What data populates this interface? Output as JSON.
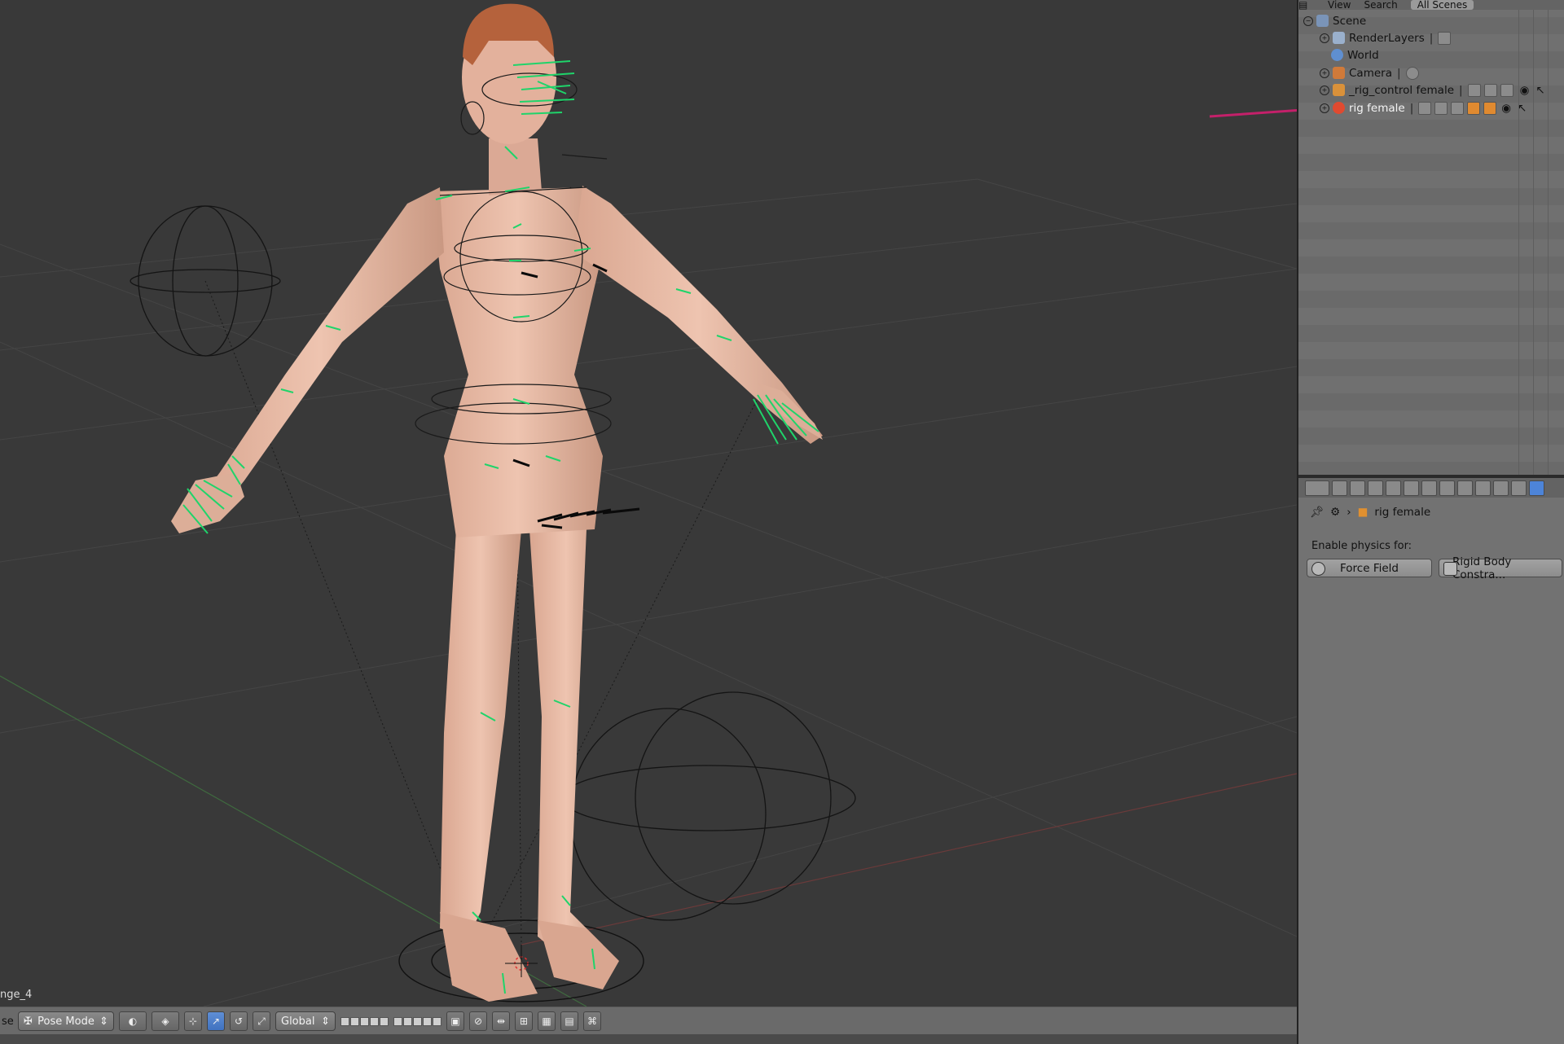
{
  "viewport": {
    "object_label": "nge_4"
  },
  "view3d_header": {
    "left_fragment": "se",
    "mode": "Pose Mode",
    "orientation": "Global"
  },
  "outliner": {
    "menus": [
      "View",
      "Search"
    ],
    "scene_filter": "All Scenes",
    "rows": [
      {
        "label": "Scene",
        "icon": "scene-icon"
      },
      {
        "label": "RenderLayers",
        "icon": "render-layers-icon"
      },
      {
        "label": "World",
        "icon": "world-icon"
      },
      {
        "label": "Camera",
        "icon": "camera-icon"
      },
      {
        "label": "_rig_control female",
        "icon": "armature-icon"
      },
      {
        "label": "rig female",
        "icon": "armature-icon"
      }
    ]
  },
  "properties": {
    "context_object": "rig female",
    "section_label": "Enable physics for:",
    "buttons": {
      "force_field": "Force Field",
      "rigid_body_constraint": "Rigid Body Constra..."
    }
  },
  "colors": {
    "annotation_arrow": "#c4206a",
    "bone_green": "#1fd46a",
    "active_tab": "#4d84d8"
  }
}
